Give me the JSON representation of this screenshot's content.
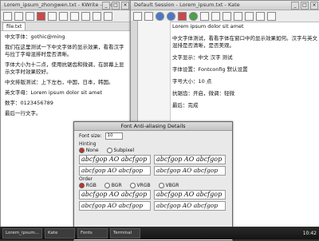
{
  "left_window": {
    "title": "Lorem_ipsum_zhongwen.txt - KWrite - gedit",
    "tabs": [
      "file.txt"
    ],
    "paragraphs": [
      "中文字体：gothic@ming",
      "我们在这里测试一下中文字体的显示效果，看看汉字与拉丁字母混排时是否清晰。",
      "字体大小为十二点，使用抗锯齿和微调，在屏幕上显示文字时效果较好。",
      "中文排版测试：上下左右，中国，日本，韩国。",
      "英文字母：Lorem ipsum dolor sit amet",
      "数字：0123456789",
      "最后一行文字。"
    ]
  },
  "right_window": {
    "title": "Default Session - Lorem_ipsum.txt - Kate",
    "paragraphs": [
      "Lorem ipsum dolor sit amet",
      "中文字体测试，看看字体在窗口中的显示效果如何。汉字与英文混排是否清晰，是否美观。",
      "文字显示：中文 汉字 测试",
      "字体设置：Fontconfig 默认设置",
      "字号大小：10 点",
      "抗锯齿：开启，微调：轻微",
      "最后：完成"
    ]
  },
  "dialog": {
    "title": "Font Anti-aliasing Details",
    "size_label": "Font size:",
    "size_value": "10",
    "hinting_label": "Hinting",
    "hint_left_label": "None",
    "hint_right_label": "Subpixel",
    "samples": [
      "abcfgop AO abcfgop",
      "abcfgop AO abcfgop",
      "abcfgop AO abcfgop",
      "abcfgop AO abcfgop",
      "abcfgop AO abcfgop",
      "abcfgop AO abcfgop",
      "abcfgop AO abcfgop",
      "abcfgop AO abcfgop"
    ],
    "order_label": "Order",
    "order_options": [
      "RGB",
      "BGR",
      "VRGB",
      "VBGR"
    ]
  },
  "taskbar": {
    "items": [
      "Lorem_ipsum...",
      "Kate",
      "Fonts",
      "Terminal"
    ],
    "clock": "10:42"
  }
}
